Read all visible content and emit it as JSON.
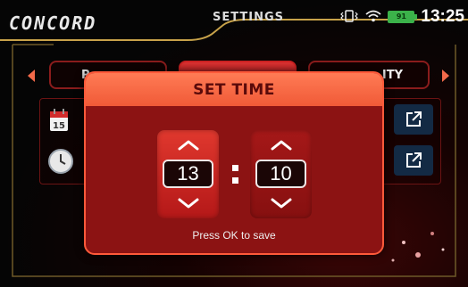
{
  "header": {
    "brand": "CONCORD",
    "title": "SETTINGS",
    "battery_level": "91",
    "time": "13:25"
  },
  "tabs": [
    {
      "label": "P",
      "selected": false
    },
    {
      "label": "",
      "selected": true
    },
    {
      "label": "ITY",
      "selected": false
    }
  ],
  "list": {
    "rows": [
      {
        "icon": "calendar-icon",
        "calendar_day": "15"
      },
      {
        "icon": "clock-icon"
      }
    ]
  },
  "modal": {
    "title": "SET TIME",
    "hours": "13",
    "minutes": "10",
    "separator": ":",
    "hint": "Press OK to save"
  },
  "colors": {
    "accent": "#f05a37",
    "modal_bg": "#8c1313",
    "tab_border": "#8a1c1c",
    "edit_button": "#132a44"
  }
}
